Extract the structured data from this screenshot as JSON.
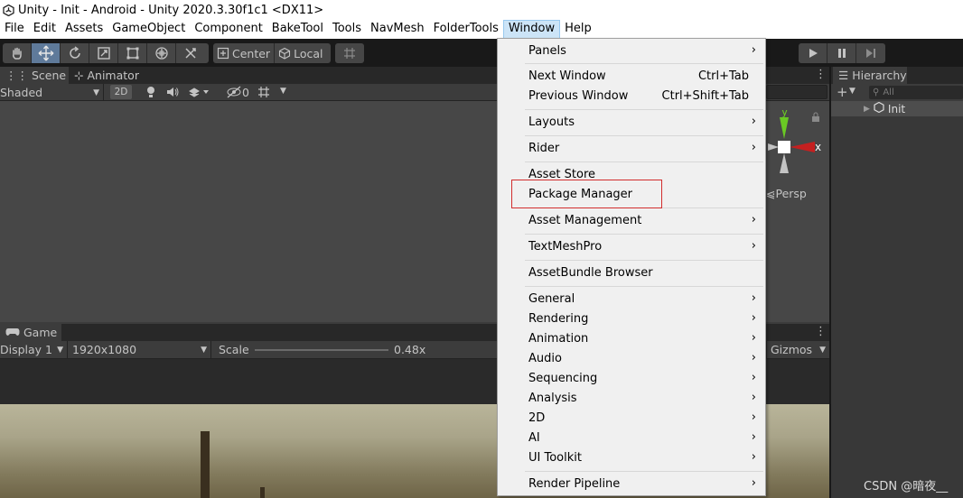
{
  "window": {
    "title": "Unity - Init - Android - Unity 2020.3.30f1c1 <DX11>"
  },
  "menubar": {
    "items": [
      "File",
      "Edit",
      "Assets",
      "GameObject",
      "Component",
      "BakeTool",
      "Tools",
      "NavMesh",
      "FolderTools",
      "Window",
      "Help"
    ],
    "active": "Window"
  },
  "toolbar": {
    "pivot_center": "Center",
    "pivot_local": "Local"
  },
  "scene": {
    "tab_scene": "Scene",
    "tab_animator": "Animator",
    "shading_mode": "Shaded",
    "mode_2d": "2D",
    "hidden_count": "0",
    "persp_label": "Persp",
    "gizmo_y": "y",
    "gizmo_x": "x"
  },
  "game": {
    "tab_label": "Game",
    "display": "Display 1",
    "resolution": "1920x1080",
    "scale_label": "Scale",
    "scale_value": "0.48x",
    "gizmos": "Gizmos"
  },
  "hierarchy": {
    "title": "Hierarchy",
    "search_placeholder": "All",
    "root_item": "Init"
  },
  "window_menu": {
    "items": [
      {
        "label": "Panels",
        "submenu": true
      },
      {
        "label": "Next Window",
        "shortcut": "Ctrl+Tab"
      },
      {
        "label": "Previous Window",
        "shortcut": "Ctrl+Shift+Tab"
      },
      {
        "label": "Layouts",
        "submenu": true
      },
      {
        "label": "Rider",
        "submenu": true
      },
      {
        "label": "Asset Store"
      },
      {
        "label": "Package Manager",
        "highlighted": true
      },
      {
        "label": "Asset Management",
        "submenu": true
      },
      {
        "label": "TextMeshPro",
        "submenu": true
      },
      {
        "label": "AssetBundle Browser"
      },
      {
        "label": "General",
        "submenu": true
      },
      {
        "label": "Rendering",
        "submenu": true
      },
      {
        "label": "Animation",
        "submenu": true
      },
      {
        "label": "Audio",
        "submenu": true
      },
      {
        "label": "Sequencing",
        "submenu": true
      },
      {
        "label": "Analysis",
        "submenu": true
      },
      {
        "label": "2D",
        "submenu": true
      },
      {
        "label": "AI",
        "submenu": true
      },
      {
        "label": "UI Toolkit",
        "submenu": true
      },
      {
        "label": "Render Pipeline",
        "submenu": true
      }
    ]
  },
  "watermark": "CSDN @暗夜__",
  "colors": {
    "highlight_box": "#d22d2d",
    "menu_bg": "#f0f0f0",
    "editor_bg": "#3c3c3c",
    "active_tool": "#5f7a9a"
  }
}
